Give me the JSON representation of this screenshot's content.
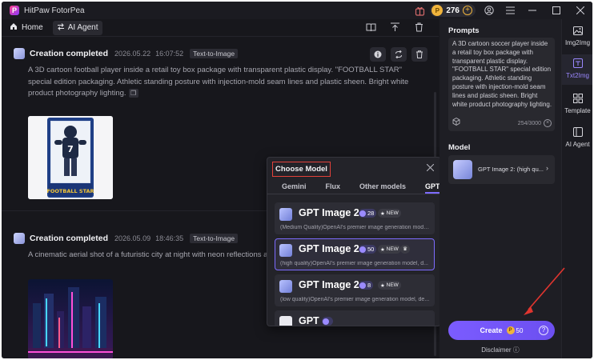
{
  "app": {
    "title": "HitPaw FotorPea",
    "logo_letter": "P"
  },
  "titlebar": {
    "credits": "276"
  },
  "toolbar": {
    "home_label": "Home",
    "agent_label": "AI Agent"
  },
  "feed": [
    {
      "title": "Creation completed",
      "date": "2026.05.22",
      "time": "16:07:52",
      "tag": "Text-to-Image",
      "prompt": "A 3D cartoon football player inside a retail toy box package with transparent plastic display. \"FOOTBALL STAR\" special edition packaging. Athletic standing posture with injection-mold seam lines and plastic sheen. Bright white product photography lighting."
    },
    {
      "title": "Creation completed",
      "date": "2026.05.09",
      "time": "18:46:35",
      "tag": "Text-to-Image",
      "prompt": "A cinematic aerial shot of a futuristic city at night with neon reflections and"
    }
  ],
  "thumb1": {
    "number": "7",
    "box_text": "FOOTBALL STAR"
  },
  "popup": {
    "title": "Choose Model",
    "tabs": [
      "Gemini",
      "Flux",
      "Other models",
      "GPT"
    ],
    "models": [
      {
        "name": "GPT Image 2",
        "cost": "28",
        "badge": "NEW",
        "desc": "(Medium Quality)OpenAI's premier image generation model..."
      },
      {
        "name": "GPT Image 2",
        "cost": "50",
        "badge": "NEW",
        "desc": "(high quality)OpenAI's premier image generation model, d..."
      },
      {
        "name": "GPT Image 2",
        "cost": "8",
        "badge": "NEW",
        "desc": "(low quality)OpenAI's premier image generation model, de..."
      },
      {
        "name": "GPT",
        "cost": ""
      }
    ]
  },
  "right_panel": {
    "prompts_label": "Prompts",
    "prompt_text": "A 3D cartoon soccer player inside a retail toy box package with transparent plastic display. \"FOOTBALL STAR\" special edition packaging. Athletic standing posture with injection-mold seam lines and plastic sheen. Bright white product photography lighting.",
    "char_count": "254/3000",
    "model_label": "Model",
    "model_name": "GPT Image 2: (high qu...",
    "create_label": "Create",
    "create_cost": "50",
    "disclaimer": "Disclaimer"
  },
  "side_nav": [
    {
      "label": "Img2Img",
      "icon": "image-icon"
    },
    {
      "label": "Txt2Img",
      "icon": "text-image-icon"
    },
    {
      "label": "Template",
      "icon": "template-icon"
    },
    {
      "label": "AI Agent",
      "icon": "ai-agent-icon"
    }
  ],
  "colors": {
    "accent": "#7d6cff",
    "highlight": "#e2413a",
    "coin": "#f0b43c"
  }
}
